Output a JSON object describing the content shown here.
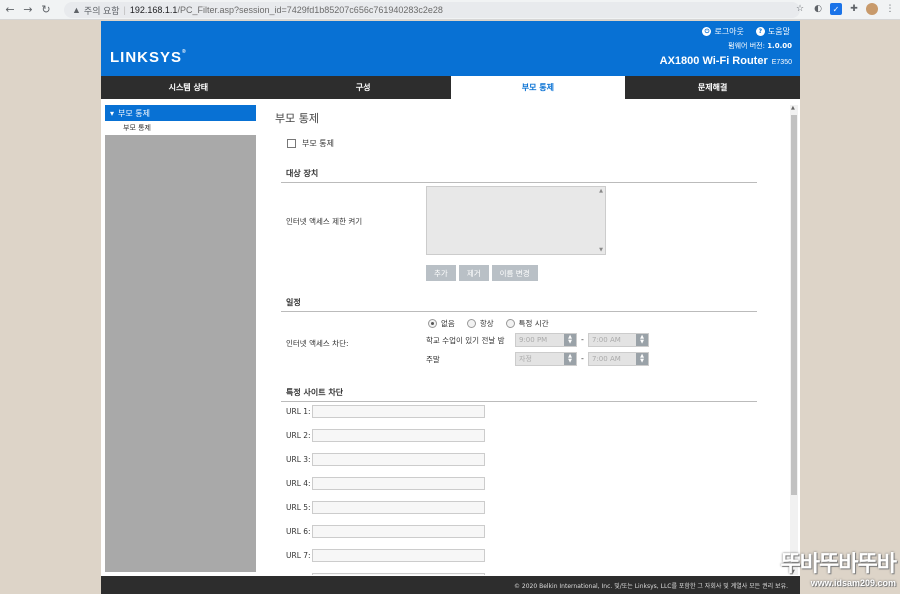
{
  "browser": {
    "warning_text": "주의 요함",
    "url_host": "192.168.1.1",
    "url_path": "/PC_Filter.asp?session_id=7429fd1b85207c656c761940283c2e28"
  },
  "header": {
    "logo": "LINKSYS",
    "logout": "로그아웃",
    "help": "도움말",
    "firmware_label": "펌웨어 버전:",
    "firmware_version": "1.0.00",
    "model": "AX1800 Wi-Fi Router",
    "model_code": "E7350"
  },
  "tabs": [
    {
      "label": "시스템 상태",
      "active": false
    },
    {
      "label": "구성",
      "active": false
    },
    {
      "label": "부모 통제",
      "active": true
    },
    {
      "label": "문제해결",
      "active": false
    }
  ],
  "sidebar": {
    "section": "부모 통제",
    "item": "부모 통제"
  },
  "content": {
    "title": "부모 통제",
    "enable_label": "부모 통제",
    "target_section": "대상 장치",
    "target_label": "인터넷 액세스 제한 켜기",
    "buttons": {
      "add": "추가",
      "remove": "제거",
      "rename": "이름 변경"
    },
    "schedule_section": "일정",
    "block_label": "인터넷 액세스 차단:",
    "radio_options": [
      {
        "label": "없음",
        "selected": true
      },
      {
        "label": "항상",
        "selected": false
      },
      {
        "label": "특정 시간",
        "selected": false
      }
    ],
    "school_nights_label": "학교 수업이 있기 전날 밤",
    "school_from": "9:00 PM",
    "school_to": "7:00 AM",
    "weekend_label": "주말",
    "weekend_from": "자정",
    "weekend_to": "7:00 AM",
    "time_separator": "-",
    "sites_section": "특정 사이트 차단",
    "url_labels": [
      "URL 1:",
      "URL 2:",
      "URL 3:",
      "URL 4:",
      "URL 5:",
      "URL 6:",
      "URL 7:"
    ]
  },
  "footer": {
    "copyright": "© 2020 Belkin International, Inc. 및/또는 Linksys, LLC를 포함한 그 자회사 및 계열사 모든 권리 보유."
  },
  "watermark": {
    "big": "뚜바뚜바뚜바",
    "small": "www.idsam209.com"
  }
}
